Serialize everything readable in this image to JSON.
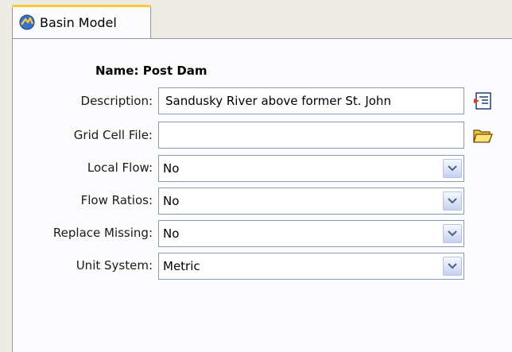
{
  "tab": {
    "label": "Basin Model",
    "icon": "basin-model-icon"
  },
  "form": {
    "name_label": "Name:",
    "name_value": "Post Dam",
    "description": {
      "label": "Description:",
      "value": "Sandusky River above former St. John",
      "button_icon": "edit-text-icon"
    },
    "grid_cell_file": {
      "label": "Grid Cell File:",
      "value": "",
      "button_icon": "open-folder-icon"
    },
    "local_flow": {
      "label": "Local Flow:",
      "value": "No"
    },
    "flow_ratios": {
      "label": "Flow Ratios:",
      "value": "No"
    },
    "replace_missing": {
      "label": "Replace Missing:",
      "value": "No"
    },
    "unit_system": {
      "label": "Unit System:",
      "value": "Metric"
    }
  },
  "colors": {
    "tab_accent": "#ffc83c",
    "field_border": "#7f9db9",
    "background": "#ecebe6"
  }
}
